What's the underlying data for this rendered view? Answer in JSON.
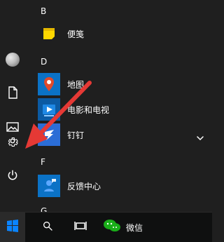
{
  "sections": {
    "b": "B",
    "d": "D",
    "f": "F",
    "g": "G"
  },
  "apps": [
    {
      "label": "便笺",
      "icon": "sticky-notes-icon",
      "color": "#1f1f1f",
      "accent": "#ffd700"
    },
    {
      "label": "地图",
      "icon": "maps-icon",
      "color": "#0b72c6",
      "accent": "#e04a2b"
    },
    {
      "label": "电影和电视",
      "icon": "movies-tv-icon",
      "color": "#0b5aa3",
      "accent": "#1e88e5"
    },
    {
      "label": "钉钉",
      "icon": "dingtalk-icon",
      "color": "#2b6dd6",
      "accent": "#ffffff"
    },
    {
      "label": "反馈中心",
      "icon": "feedback-hub-icon",
      "color": "#0b72c6",
      "accent": "#5ca8ff"
    }
  ],
  "rail": [
    {
      "name": "user-avatar",
      "icon": "avatar-icon"
    },
    {
      "name": "documents",
      "icon": "document-icon"
    },
    {
      "name": "pictures",
      "icon": "picture-icon"
    },
    {
      "name": "settings",
      "icon": "gear-icon"
    },
    {
      "name": "power",
      "icon": "power-icon"
    }
  ],
  "taskbar": {
    "wechat_label": "微信"
  },
  "colors": {
    "accent": "#0078d7",
    "arrow": "#e53935",
    "background": "#1f1f1f",
    "taskbar": "#0f1010"
  }
}
